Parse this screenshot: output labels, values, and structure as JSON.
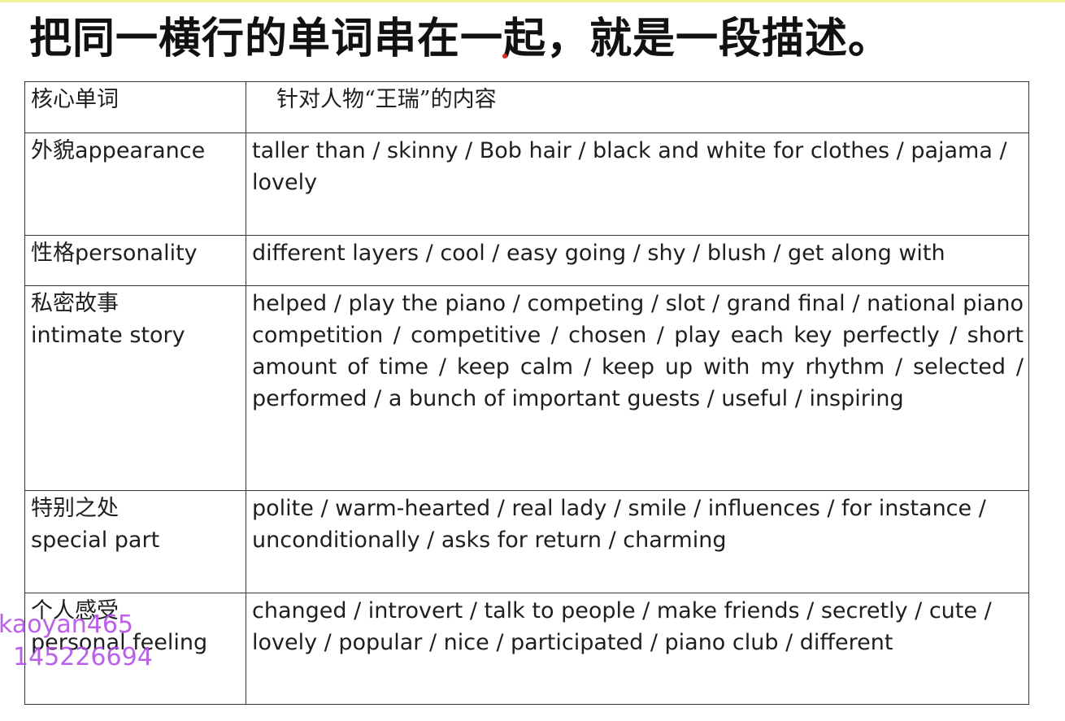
{
  "title": "把同一横行的单词串在一起，就是一段描述。",
  "table": {
    "header": {
      "key": "核心单词",
      "content": "针对人物“王瑞”的内容"
    },
    "rows": [
      {
        "key_zh": "外貌",
        "key_en": "appearance",
        "content": "taller than / skinny / Bob hair / black and white for clothes / pajama / lovely"
      },
      {
        "key_zh": "性格",
        "key_en": "personality",
        "content": "different layers / cool / easy going / shy / blush / get along with"
      },
      {
        "key_zh": "私密故事",
        "key_en": "intimate story",
        "content": "helped / play the piano / competing / slot / grand final / national piano competition / competitive / chosen / play each key perfectly / short amount of time / keep calm / keep up with my rhythm / selected / performed / a bunch of important guests / useful / inspiring"
      },
      {
        "key_zh": "特别之处",
        "key_en": "special part",
        "content": "polite / warm-hearted / real lady / smile / influences / for instance / unconditionally / asks for return / charming"
      },
      {
        "key_zh": "个人感受",
        "key_en": "personal feeling",
        "content": "changed / introvert / talk to people / make friends / secretly / cute / lovely / popular / nice / participated / piano club / different"
      }
    ]
  },
  "watermark": {
    "line1": "kaoyan465",
    "line2": "145226694",
    "color": "#b44fe6"
  }
}
